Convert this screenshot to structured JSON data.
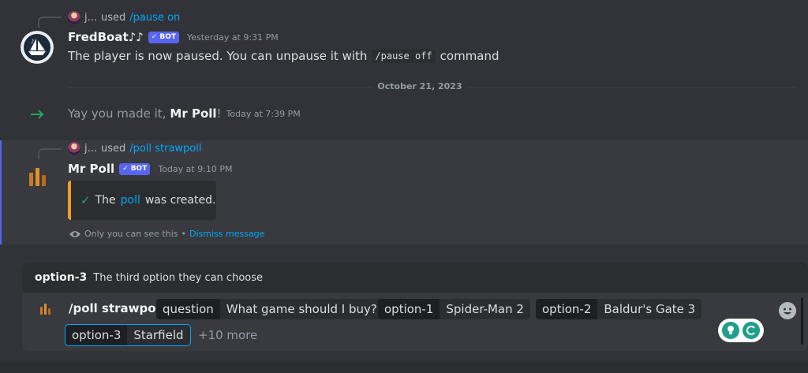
{
  "messages": [
    {
      "reply": {
        "user": "j...",
        "used": "used",
        "command": "/pause on"
      },
      "author": "FredBoat♪♪",
      "badge": "BOT",
      "timestamp": "Yesterday at 9:31 PM",
      "text_before": "The player is now paused. You can unpause it with",
      "code": "/pause off",
      "text_after": "command"
    },
    {
      "system_text_before": "Yay you made it,",
      "system_user": "Mr Poll",
      "system_text_after": "!",
      "timestamp": "Today at 7:39 PM"
    },
    {
      "reply": {
        "user": "j...",
        "used": "used",
        "command": "/poll strawpoll"
      },
      "author": "Mr Poll",
      "badge": "BOT",
      "timestamp": "Today at 9:10 PM",
      "embed": {
        "before": "The",
        "link": "poll",
        "after": "was created."
      },
      "ephemeral": {
        "notice": "Only you can see this",
        "sep": "•",
        "dismiss": "Dismiss message"
      }
    }
  ],
  "divider": {
    "date": "October 21, 2023"
  },
  "option_hint": {
    "name": "option-3",
    "description": "The third option they can choose"
  },
  "composer": {
    "command": "/poll strawpoll",
    "options": [
      {
        "key": "question",
        "value": "What game should I buy?"
      },
      {
        "key": "option-1",
        "value": "Spider-Man 2"
      },
      {
        "key": "option-2",
        "value": "Baldur's Gate 3"
      },
      {
        "key": "option-3",
        "value": "Starfield"
      }
    ],
    "more": "+10 more"
  },
  "colors": {
    "accent": "#5865f2",
    "link": "#00a8fc",
    "embed_border": "#f0a020",
    "join_arrow": "#23a55a"
  },
  "icons": [
    "fredboat-avatar",
    "mrpoll-avatar",
    "join-arrow-icon",
    "check-icon",
    "eye-icon",
    "emoji-icon",
    "verified-check-icon"
  ]
}
